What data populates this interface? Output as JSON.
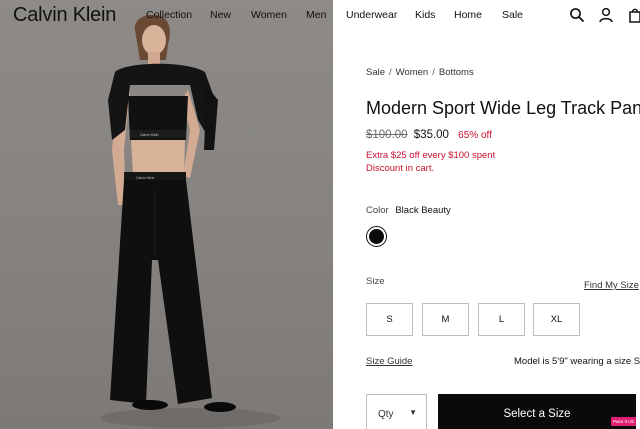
{
  "header": {
    "logo": "Calvin Klein",
    "nav": [
      "Collection",
      "New",
      "Women",
      "Men",
      "Underwear",
      "Kids",
      "Home",
      "Sale"
    ],
    "icons": [
      "search-icon",
      "account-icon",
      "bag-icon"
    ]
  },
  "breadcrumb": [
    "Sale",
    "Women",
    "Bottoms"
  ],
  "product": {
    "title": "Modern Sport Wide Leg Track Pants",
    "price_original": "$100.00",
    "price_sale": "$35.00",
    "discount": "65% off",
    "promo_line1": "Extra $25 off every $100 spent",
    "promo_line2": "Discount in cart.",
    "color_label": "Color",
    "color_value": "Black Beauty",
    "size_label": "Size",
    "find_my_size": "Find My Size",
    "sizes": [
      "S",
      "M",
      "L",
      "XL"
    ],
    "size_guide": "Size Guide",
    "model_note": "Model is 5'9\" wearing a size S",
    "qty_label": "Qty",
    "cta": "Select a Size"
  },
  "badge": "Paint It Ub",
  "colors": {
    "accent_red": "#c8102e",
    "cta_bg": "#0a0a0a",
    "swatch": "#0b0b0b",
    "badge": "#e11d74"
  }
}
